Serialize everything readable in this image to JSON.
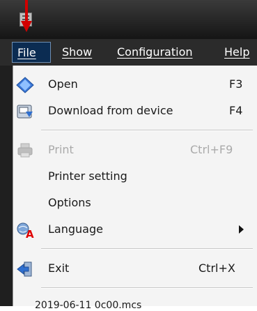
{
  "menubar": {
    "file": "File",
    "show": "Show",
    "configuration": "Configuration",
    "help": "Help"
  },
  "file_menu": {
    "items": [
      {
        "label": "Open",
        "shortcut": "F3",
        "icon": "open-icon"
      },
      {
        "label": "Download from device",
        "shortcut": "F4",
        "icon": "download-icon"
      },
      {
        "label": "Print",
        "shortcut": "Ctrl+F9",
        "icon": "printer-icon",
        "disabled": true
      },
      {
        "label": "Printer setting",
        "shortcut": ""
      },
      {
        "label": "Options",
        "shortcut": ""
      },
      {
        "label": "Language",
        "shortcut": "",
        "icon": "language-icon",
        "submenu": true
      },
      {
        "label": "Exit",
        "shortcut": "Ctrl+X",
        "icon": "exit-icon"
      }
    ],
    "footer": "2019-06-11 0c00.mcs"
  },
  "colors": {
    "title_bar": "#1b1b1b",
    "menubar": "#2b2b2b",
    "file_highlight": "#0b2c52",
    "annotation_arrow": "#d10000"
  }
}
